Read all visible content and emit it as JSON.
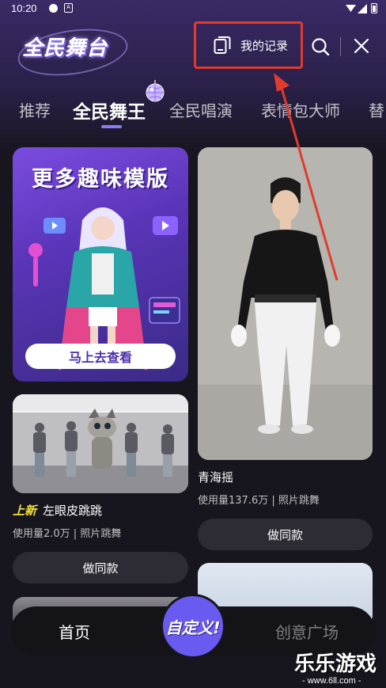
{
  "status_bar": {
    "time": "10:20",
    "notification_badge": "A"
  },
  "app": {
    "logo_text": "全民舞台"
  },
  "header": {
    "records_label": "我的记录"
  },
  "tabs": [
    {
      "label": "推荐"
    },
    {
      "label": "全民舞王",
      "active": true
    },
    {
      "label": "全民唱演"
    },
    {
      "label": "表情包大师"
    },
    {
      "label": "替"
    }
  ],
  "promo": {
    "title": "更多趣味模版",
    "cta": "马上去查看"
  },
  "items": [
    {
      "badge": "上新",
      "title": "左眼皮跳跳",
      "meta": "使用量2.0万 | 照片跳舞",
      "button": "做同款"
    },
    {
      "title": "青海摇",
      "meta": "使用量137.6万 | 照片跳舞",
      "button": "做同款"
    }
  ],
  "bottom_nav": {
    "home": "首页",
    "custom": "自定义!",
    "plaza": "创意广场"
  },
  "watermark": {
    "title": "乐乐游戏",
    "url": "- www.6ll.com -"
  },
  "colors": {
    "accent": "#6a5bf0",
    "highlight_box": "#e23b2e",
    "new_badge": "#f2e23a"
  },
  "icons": [
    "records-icon",
    "search-icon",
    "close-icon",
    "disco-ball-icon",
    "wifi-icon",
    "signal-icon",
    "battery-icon"
  ]
}
